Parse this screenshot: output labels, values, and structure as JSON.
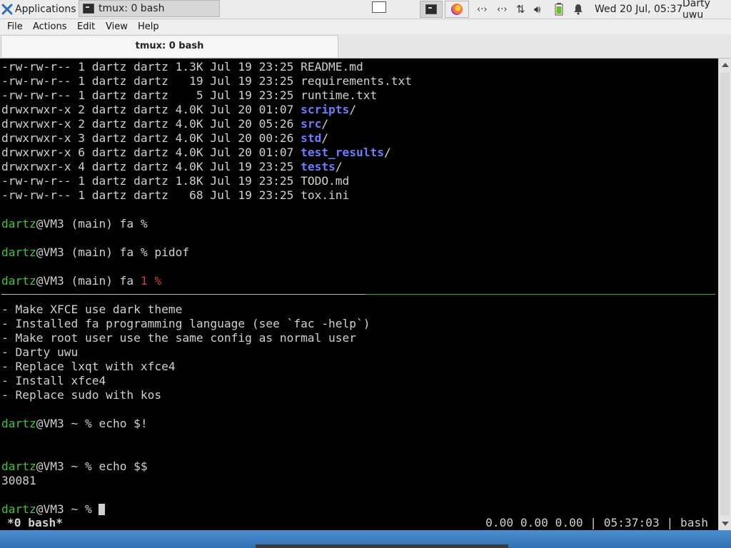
{
  "panel": {
    "applications": "Applications",
    "task_title": "tmux: 0 bash",
    "clock": "Wed 20 Jul, 05:37",
    "user": "Darty uwu",
    "tray_icons": [
      "network-icon",
      "network-icon",
      "transfer-icon",
      "volume-icon",
      "battery-icon",
      "notification-bell-icon"
    ]
  },
  "menu": {
    "file": "File",
    "actions": "Actions",
    "edit": "Edit",
    "view": "View",
    "help": "Help"
  },
  "tab": {
    "title": "tmux: 0 bash"
  },
  "listing": [
    {
      "meta": "-rw-rw-r-- 1 dartz dartz 1.3K Jul 19 23:25 ",
      "name": "README.md",
      "dir": false
    },
    {
      "meta": "-rw-rw-r-- 1 dartz dartz   19 Jul 19 23:25 ",
      "name": "requirements.txt",
      "dir": false
    },
    {
      "meta": "-rw-rw-r-- 1 dartz dartz    5 Jul 19 23:25 ",
      "name": "runtime.txt",
      "dir": false
    },
    {
      "meta": "drwxrwxr-x 2 dartz dartz 4.0K Jul 20 01:07 ",
      "name": "scripts",
      "dir": true
    },
    {
      "meta": "drwxrwxr-x 2 dartz dartz 4.0K Jul 20 05:26 ",
      "name": "src",
      "dir": true
    },
    {
      "meta": "drwxrwxr-x 3 dartz dartz 4.0K Jul 20 00:26 ",
      "name": "std",
      "dir": true
    },
    {
      "meta": "drwxrwxr-x 6 dartz dartz 4.0K Jul 20 01:07 ",
      "name": "test_results",
      "dir": true
    },
    {
      "meta": "drwxrwxr-x 4 dartz dartz 4.0K Jul 19 23:25 ",
      "name": "tests",
      "dir": true
    },
    {
      "meta": "-rw-rw-r-- 1 dartz dartz 1.8K Jul 19 23:25 ",
      "name": "TODO.md",
      "dir": false
    },
    {
      "meta": "-rw-rw-r-- 1 dartz dartz   68 Jul 19 23:25 ",
      "name": "tox.ini",
      "dir": false
    }
  ],
  "top_pane": {
    "prompt_user": "dartz",
    "prompt_rest": "@VM3 (main) fa ",
    "prompt_sym": "%",
    "cmd_pidof": " pidof",
    "err_code": "1 %"
  },
  "todo": [
    "- Make XFCE use dark theme",
    "- Installed fa programming language (see `fac -help`)",
    "- Make root user use the same config as normal user",
    "- Darty uwu",
    "- Replace lxqt with xfce4",
    "- Install xfce4",
    "- Replace sudo with kos"
  ],
  "bottom_pane": {
    "prompt_user": "dartz",
    "prompt_rest": "@VM3 ~ % ",
    "cmd1": "echo $!",
    "cmd2": "echo $$",
    "output2": "30081"
  },
  "status": {
    "left": "*0 bash*",
    "right": "0.00 0.00 0.00 | 05:37:03 | bash"
  }
}
